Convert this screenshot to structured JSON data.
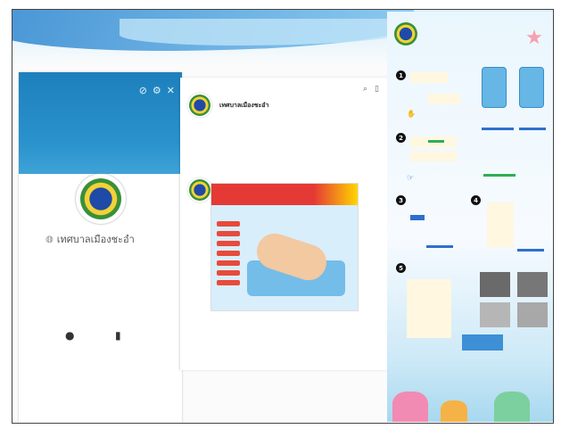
{
  "profile": {
    "name": "เทศบาลเมืองชะอำ",
    "subtitle": "",
    "actions": [
      {
        "icon": "chat-icon",
        "label": ""
      },
      {
        "icon": "note-icon",
        "label": ""
      }
    ]
  },
  "chat": {
    "title": "เทศบาลเมืองชะอำ",
    "subtitle": "",
    "date": "",
    "input_placeholder": ""
  },
  "poster": {
    "headline_left": "",
    "headline_right": ""
  },
  "infographic": {
    "title_line1": "",
    "title_line2": "",
    "title_line3": "",
    "steps": [
      "1",
      "2",
      "3",
      "4",
      "5"
    ]
  },
  "colors": {
    "cover": "#1d80bd",
    "poster_red": "#e53935",
    "accent_blue": "#2d6fcf",
    "accent_green": "#2fae55"
  }
}
